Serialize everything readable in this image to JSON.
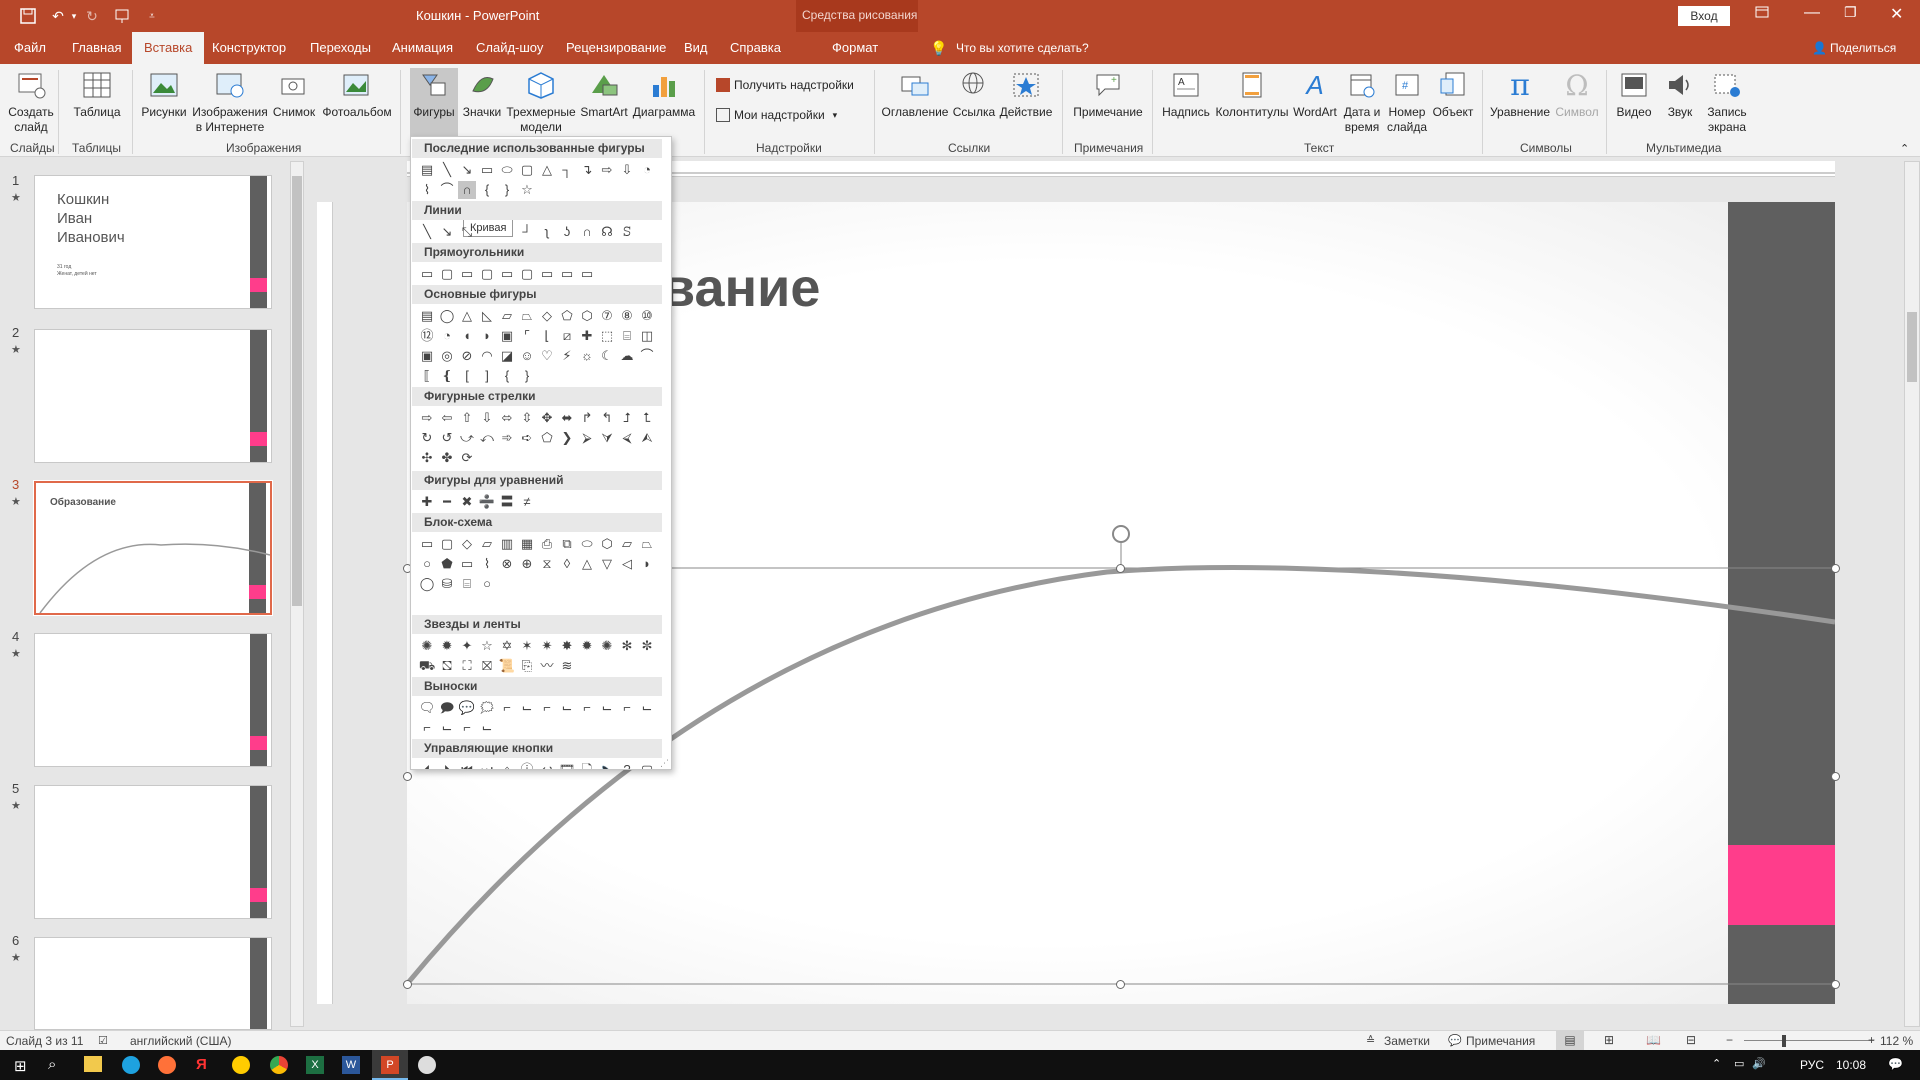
{
  "titlebar": {
    "title": "Кошкин  -  PowerPoint",
    "context_group": "Средства рисования",
    "login_button": "Вход"
  },
  "tabs": [
    {
      "label": "Файл"
    },
    {
      "label": "Главная"
    },
    {
      "label": "Вставка"
    },
    {
      "label": "Конструктор"
    },
    {
      "label": "Переходы"
    },
    {
      "label": "Анимация"
    },
    {
      "label": "Слайд-шоу"
    },
    {
      "label": "Рецензирование"
    },
    {
      "label": "Вид"
    },
    {
      "label": "Справка"
    },
    {
      "label": "Формат"
    }
  ],
  "tell_me": "Что вы хотите сделать?",
  "share": "Поделиться",
  "ribbon": {
    "new_slide": "Создать слайд",
    "table": "Таблица",
    "pictures": "Рисунки",
    "online_pictures": "Изображения в Интернете",
    "screenshot": "Снимок",
    "photo_album": "Фотоальбом",
    "shapes": "Фигуры",
    "icons": "Значки",
    "models3d": "Трехмерные модели",
    "smartart": "SmartArt",
    "chart": "Диаграмма",
    "get_addins": "Получить надстройки",
    "my_addins": "Мои надстройки",
    "zoom": "Оглавление",
    "link": "Ссылка",
    "action": "Действие",
    "comment": "Примечание",
    "textbox": "Надпись",
    "header_footer": "Колонтитулы",
    "wordart": "WordArt",
    "datetime": "Дата и время",
    "slide_number": "Номер слайда",
    "object": "Объект",
    "equation": "Уравнение",
    "symbol": "Символ",
    "video": "Видео",
    "audio": "Звук",
    "screen_rec": "Запись экрана",
    "groups": {
      "slides": "Слайды",
      "tables": "Таблицы",
      "images": "Изображения",
      "addins": "Надстройки",
      "links": "Ссылки",
      "comments": "Примечания",
      "text": "Текст",
      "symbols": "Символы",
      "media": "Мультимедиа"
    }
  },
  "dropdown": {
    "recent": "Последние использованные фигуры",
    "lines": "Линии",
    "rects": "Прямоугольники",
    "basic": "Основные фигуры",
    "arrows": "Фигурные стрелки",
    "equation": "Фигуры для уравнений",
    "flowchart": "Блок-схема",
    "stars": "Звезды и ленты",
    "callouts": "Выноски",
    "action_buttons": "Управляющие кнопки",
    "tooltip": "Кривая"
  },
  "thumbnails": [
    {
      "num": "1",
      "name_line1": "Кошкин",
      "name_line2": "Иван",
      "name_line3": "Иванович",
      "sub1": "31 год",
      "sub2": "Женат, детей нет"
    },
    {
      "num": "2"
    },
    {
      "num": "3",
      "title": "Образование"
    },
    {
      "num": "4"
    },
    {
      "num": "5"
    },
    {
      "num": "6"
    }
  ],
  "slide": {
    "title_visible": "вание"
  },
  "status": {
    "slide_count": "Слайд 3 из 11",
    "language": "английский (США)",
    "notes": "Заметки",
    "comments": "Примечания",
    "zoom": "112 %"
  },
  "taskbar": {
    "lang": "РУС",
    "time": "10:08"
  },
  "colors": {
    "accent": "#b7472a",
    "pink": "#ff3d8b",
    "bar": "#5f5f5f"
  }
}
